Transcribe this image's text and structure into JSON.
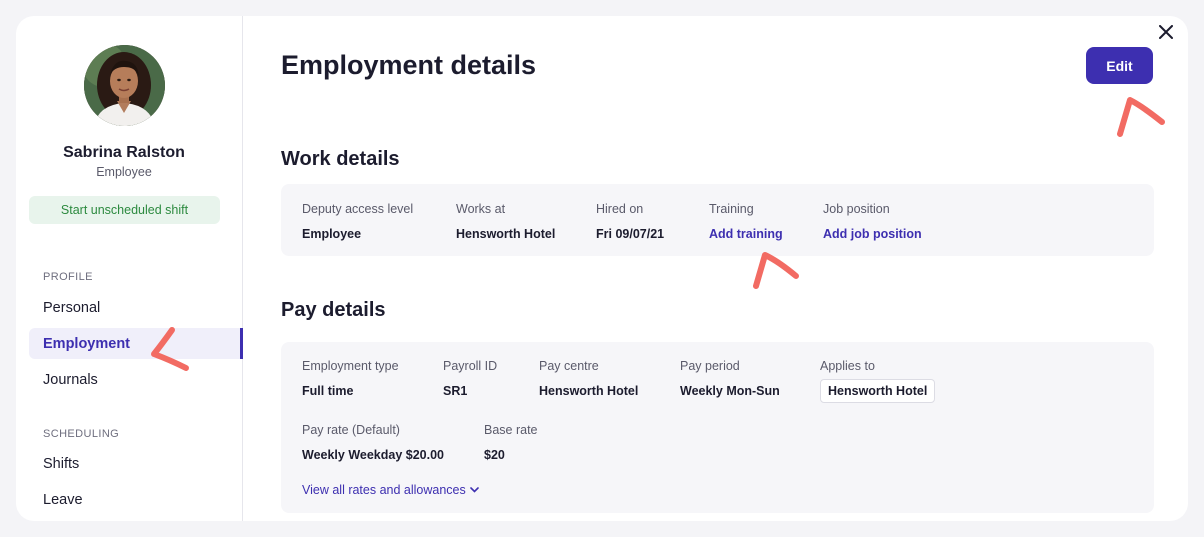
{
  "profile": {
    "name": "Sabrina Ralston",
    "role": "Employee",
    "start_shift_label": "Start unscheduled shift"
  },
  "sidebar": {
    "profile_section": "PROFILE",
    "profile_items": [
      {
        "label": "Personal"
      },
      {
        "label": "Employment"
      },
      {
        "label": "Journals"
      }
    ],
    "scheduling_section": "SCHEDULING",
    "scheduling_items": [
      {
        "label": "Shifts"
      },
      {
        "label": "Leave"
      }
    ]
  },
  "header": {
    "title": "Employment details",
    "edit_label": "Edit"
  },
  "work_details": {
    "title": "Work details",
    "fields": [
      {
        "label": "Deputy access level",
        "value": "Employee"
      },
      {
        "label": "Works at",
        "value": "Hensworth Hotel"
      },
      {
        "label": "Hired on",
        "value": "Fri 09/07/21"
      },
      {
        "label": "Training",
        "value": "Add training"
      },
      {
        "label": "Job position",
        "value": "Add job position"
      }
    ]
  },
  "pay_details": {
    "title": "Pay details",
    "row1": [
      {
        "label": "Employment type",
        "value": "Full time"
      },
      {
        "label": "Payroll ID",
        "value": "SR1"
      },
      {
        "label": "Pay centre",
        "value": "Hensworth Hotel"
      },
      {
        "label": "Pay period",
        "value": "Weekly Mon-Sun"
      },
      {
        "label": "Applies to",
        "value": "Hensworth Hotel"
      }
    ],
    "row2": [
      {
        "label": "Pay rate (Default)",
        "value": "Weekly Weekday $20.00"
      },
      {
        "label": "Base rate",
        "value": "$20"
      }
    ],
    "view_rates_label": "View all rates and allowances"
  },
  "colors": {
    "accent": "#3d2fb0",
    "success_bg": "#e8f4ec",
    "success_text": "#2c8a3f",
    "annotation": "#f26b63"
  },
  "icons": {
    "close": "close-icon",
    "chevron": "chevron-down-icon"
  }
}
